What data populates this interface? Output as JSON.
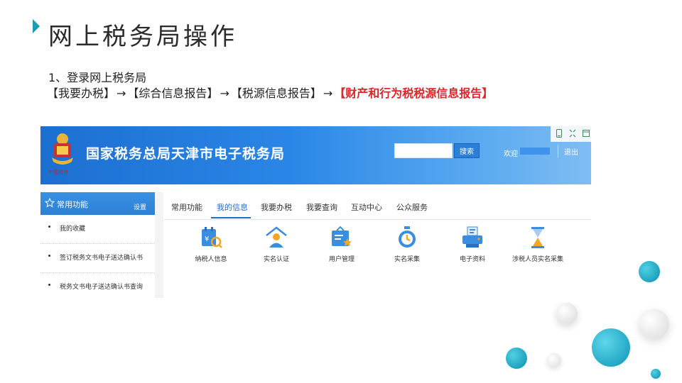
{
  "slide": {
    "title": "网上税务局操作",
    "step_line1": "1、登录网上税务局",
    "path": [
      "【我要办税】",
      "【综合信息报告】",
      "【税源信息报告】"
    ],
    "path_highlight": "【财产和行为税税源信息报告】",
    "arrow": "→"
  },
  "site": {
    "emblem_caption": "中国税务",
    "name": "国家税务总局天津市电子税务局",
    "search_placeholder": "",
    "search_button": "搜索",
    "welcome": "欢迎",
    "logout": "退出",
    "toolbar_icons": [
      "phone-icon",
      "expand-icon",
      "window-icon"
    ]
  },
  "sidebar": {
    "title": "常用功能",
    "settings": "设置",
    "items": [
      "我的收藏",
      "签订税务文书电子送达确认书",
      "税务文书电子送达确认书查询"
    ]
  },
  "tabs": [
    "常用功能",
    "我的信息",
    "我要办税",
    "我要查询",
    "互动中心",
    "公众服务"
  ],
  "active_tab": "我的信息",
  "apps": [
    {
      "label": "纳税人信息",
      "icon": "taxpayer-info-icon"
    },
    {
      "label": "实名认证",
      "icon": "real-name-auth-icon"
    },
    {
      "label": "用户管理",
      "icon": "user-management-icon"
    },
    {
      "label": "实名采集",
      "icon": "real-name-collect-icon"
    },
    {
      "label": "电子资料",
      "icon": "e-documents-icon"
    },
    {
      "label": "涉税人员实名采集",
      "icon": "tax-staff-collect-icon"
    }
  ],
  "colors": {
    "accent": "#1f6fd0",
    "highlight": "#e0262a",
    "teal": "#1a9db0"
  }
}
